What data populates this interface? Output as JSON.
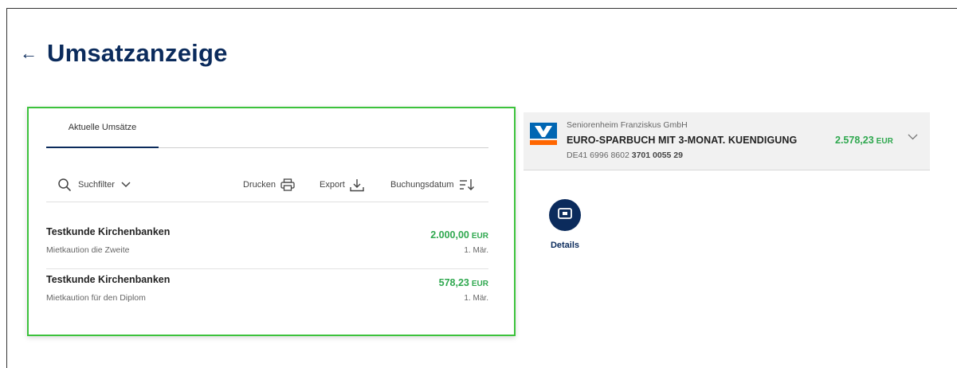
{
  "header": {
    "title": "Umsatzanzeige",
    "back_icon": "arrow-left-icon"
  },
  "transactions_panel": {
    "tabs": [
      {
        "label": "Aktuelle Umsätze",
        "active": true
      }
    ],
    "toolbar": {
      "search_label": "Suchfilter",
      "print_label": "Drucken",
      "export_label": "Export",
      "sort_label": "Buchungsdatum"
    },
    "rows": [
      {
        "name": "Testkunde Kirchenbanken",
        "description": "Mietkaution die Zweite",
        "amount": "2.000,00",
        "currency": "EUR",
        "date": "1. Mär."
      },
      {
        "name": "Testkunde Kirchenbanken",
        "description": "Mietkaution für den Diplom",
        "amount": "578,23",
        "currency": "EUR",
        "date": "1. Mär."
      }
    ]
  },
  "account": {
    "owner": "Seniorenheim Franziskus GmbH",
    "name": "EURO-SPARBUCH MIT 3-MONAT. KUENDIGUNG",
    "iban_prefix": "DE41 6996 8602",
    "iban_bold": "3701 0055 29",
    "balance": "2.578,23",
    "currency": "EUR"
  },
  "actions": {
    "details_label": "Details",
    "details_icon": "card-icon"
  },
  "colors": {
    "brand_navy": "#0b2b5c",
    "amount_green": "#2fa84f",
    "highlight_border": "#3cc23c",
    "logo_blue": "#0066b3",
    "logo_orange": "#ff6600"
  }
}
